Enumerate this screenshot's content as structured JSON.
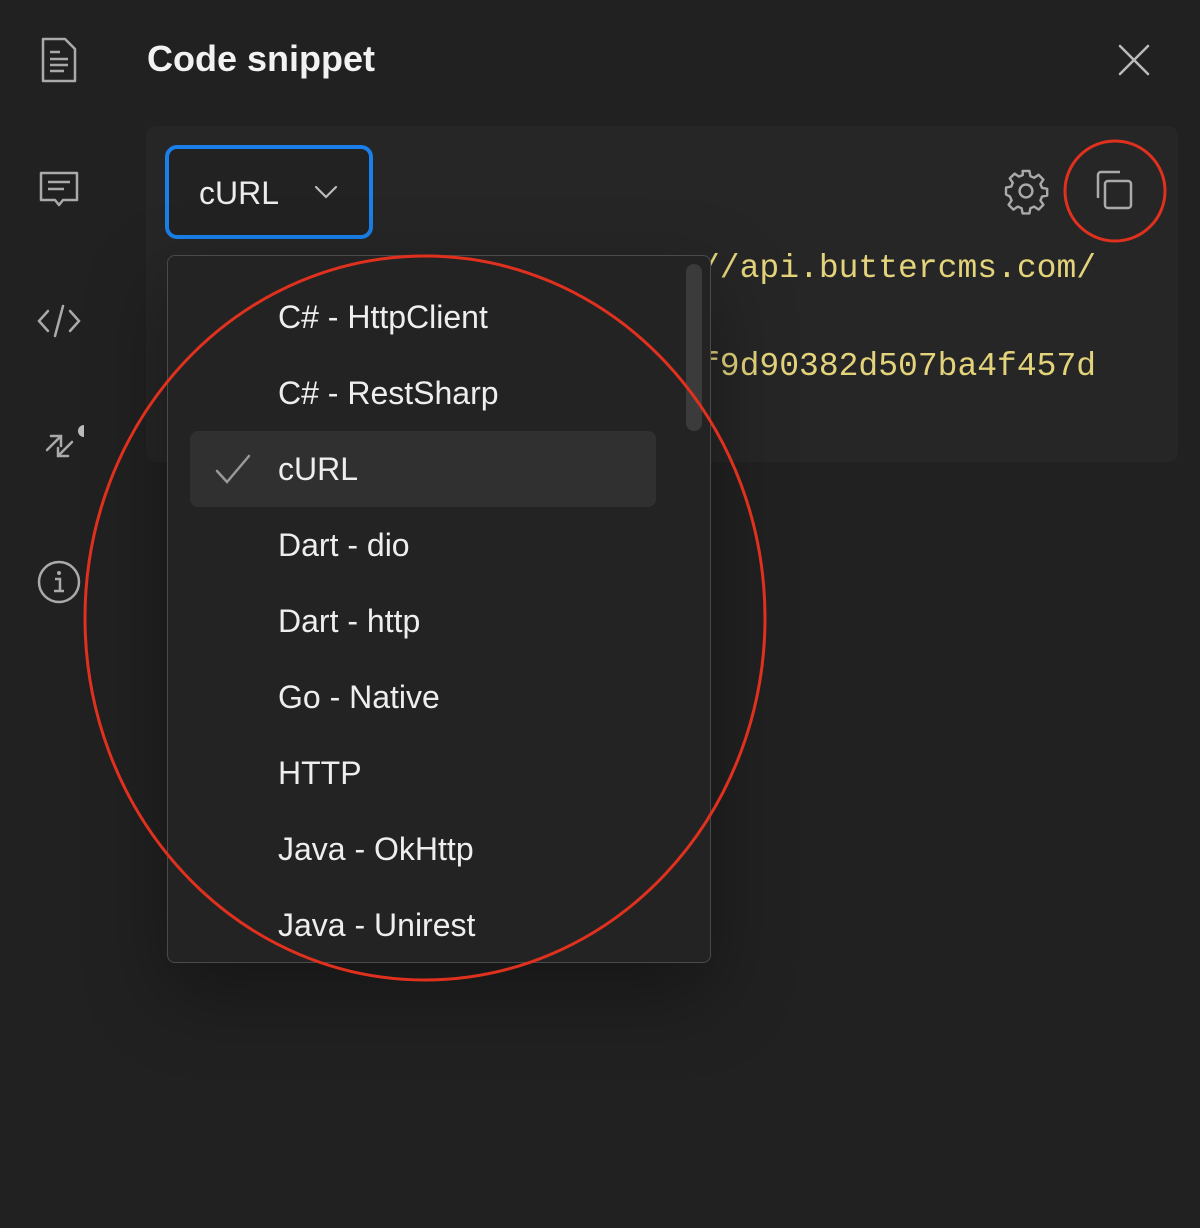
{
  "header": {
    "title": "Code snippet",
    "close_icon": "close-icon"
  },
  "sidebar": {
    "items": [
      {
        "icon": "document-icon"
      },
      {
        "icon": "comment-icon"
      },
      {
        "icon": "code-icon"
      },
      {
        "icon": "arrows-collapse-icon",
        "badge_dot": true
      },
      {
        "icon": "info-icon"
      }
    ]
  },
  "snippet": {
    "language_select": {
      "value": "cURL"
    },
    "code_lines": [
      "//api.buttercms.com/",
      "f9d90382d507ba4f457d"
    ],
    "settings_icon": "gear-icon",
    "copy_icon": "copy-icon"
  },
  "dropdown": {
    "selected": "cURL",
    "options": [
      {
        "label": "C# - HttpClient"
      },
      {
        "label": "C# - RestSharp"
      },
      {
        "label": "cURL"
      },
      {
        "label": "Dart - dio"
      },
      {
        "label": "Dart - http"
      },
      {
        "label": "Go - Native"
      },
      {
        "label": "HTTP"
      },
      {
        "label": "Java - OkHttp"
      },
      {
        "label": "Java - Unirest"
      }
    ]
  },
  "colors": {
    "background": "#212121",
    "focus_ring": "#1a7fe8",
    "code_text": "#e3d47c",
    "annotation": "#e0301e"
  }
}
